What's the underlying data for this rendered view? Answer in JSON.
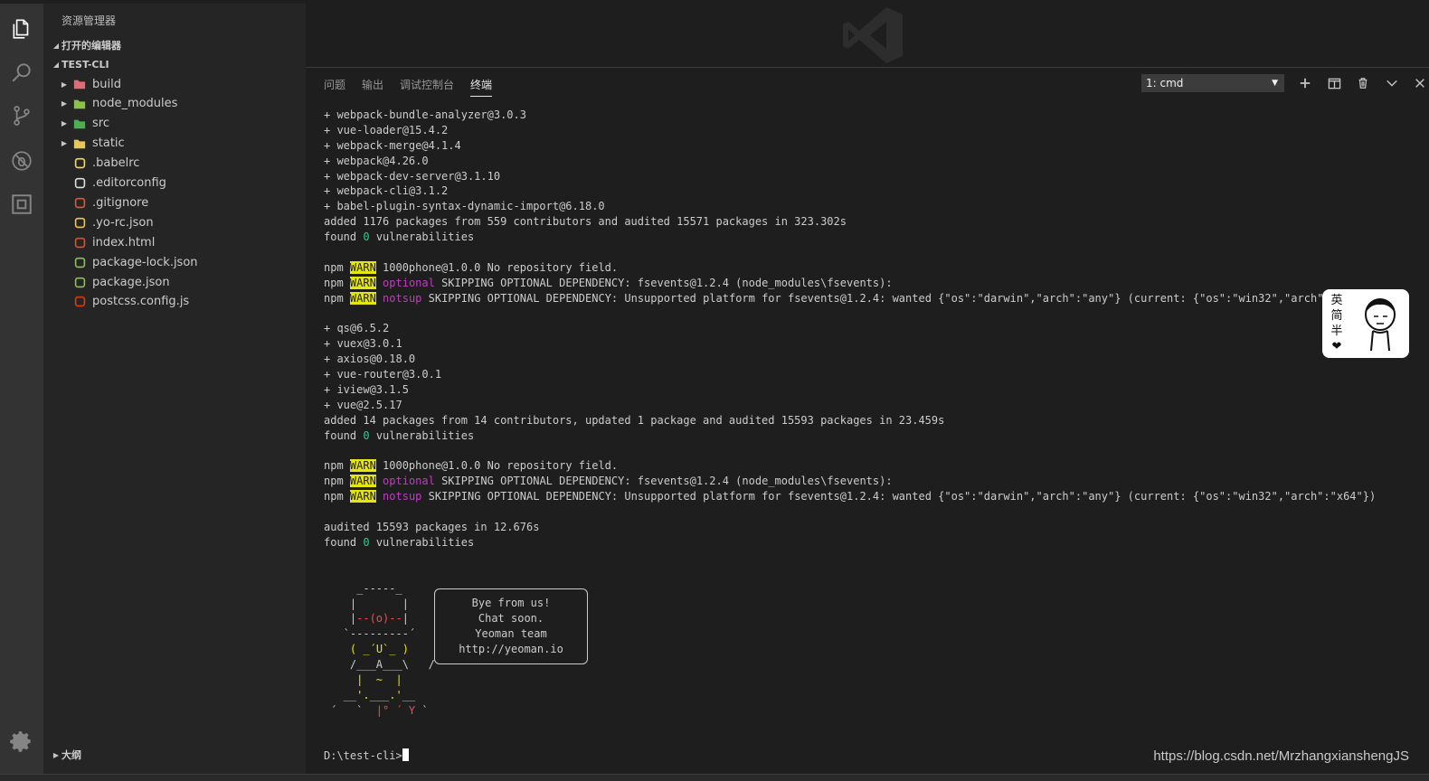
{
  "sidebar": {
    "title": "资源管理器",
    "open_editors": "打开的编辑器",
    "project": "TEST-CLI",
    "outline": "大纲",
    "items": [
      {
        "label": "build",
        "icon": "folder-build-icon",
        "folder": true,
        "color": "#e06c75"
      },
      {
        "label": "node_modules",
        "icon": "folder-node-icon",
        "folder": true,
        "color": "#8bc34a"
      },
      {
        "label": "src",
        "icon": "folder-src-icon",
        "folder": true,
        "color": "#4caf50"
      },
      {
        "label": "static",
        "icon": "folder-icon",
        "folder": true,
        "color": "#e8c75a"
      },
      {
        "label": ".babelrc",
        "icon": "babel-icon",
        "folder": false,
        "color": "#f5da55"
      },
      {
        "label": ".editorconfig",
        "icon": "editorconfig-icon",
        "folder": false,
        "color": "#dddddd"
      },
      {
        "label": ".gitignore",
        "icon": "git-icon",
        "folder": false,
        "color": "#e4572e"
      },
      {
        "label": ".yo-rc.json",
        "icon": "json-icon",
        "folder": false,
        "color": "#f5c542"
      },
      {
        "label": "index.html",
        "icon": "html5-icon",
        "folder": false,
        "color": "#e44d26"
      },
      {
        "label": "package-lock.json",
        "icon": "npm-icon",
        "folder": false,
        "color": "#8bc34a"
      },
      {
        "label": "package.json",
        "icon": "npm-icon",
        "folder": false,
        "color": "#8bc34a"
      },
      {
        "label": "postcss.config.js",
        "icon": "postcss-icon",
        "folder": false,
        "color": "#dd3a0a"
      }
    ]
  },
  "panel": {
    "tabs": [
      "问题",
      "输出",
      "调试控制台",
      "终端"
    ],
    "active_tab": "终端",
    "terminal_select": "1: cmd"
  },
  "terminal": {
    "lines": [
      [
        {
          "t": "+ webpack-bundle-analyzer@3.0.3"
        }
      ],
      [
        {
          "t": "+ vue-loader@15.4.2"
        }
      ],
      [
        {
          "t": "+ webpack-merge@4.1.4"
        }
      ],
      [
        {
          "t": "+ webpack@4.26.0"
        }
      ],
      [
        {
          "t": "+ webpack-dev-server@3.1.10"
        }
      ],
      [
        {
          "t": "+ webpack-cli@3.1.2"
        }
      ],
      [
        {
          "t": "+ babel-plugin-syntax-dynamic-import@6.18.0"
        }
      ],
      [
        {
          "t": "added 1176 packages from 559 contributors and audited 15571 packages in 323.302s"
        }
      ],
      [
        {
          "t": "found "
        },
        {
          "t": "0",
          "c": "grn"
        },
        {
          "t": " vulnerabilities"
        }
      ],
      [],
      [
        {
          "t": "npm "
        },
        {
          "t": "WARN",
          "c": "warn"
        },
        {
          "t": " 1000phone@1.0.0 No repository field."
        }
      ],
      [
        {
          "t": "npm "
        },
        {
          "t": "WARN",
          "c": "warn"
        },
        {
          "t": " "
        },
        {
          "t": "optional",
          "c": "mag"
        },
        {
          "t": " SKIPPING OPTIONAL DEPENDENCY: fsevents@1.2.4 (node_modules\\fsevents):"
        }
      ],
      [
        {
          "t": "npm "
        },
        {
          "t": "WARN",
          "c": "warn"
        },
        {
          "t": " "
        },
        {
          "t": "notsup",
          "c": "mag"
        },
        {
          "t": " SKIPPING OPTIONAL DEPENDENCY: Unsupported platform for fsevents@1.2.4: wanted {\"os\":\"darwin\",\"arch\":\"any\"} (current: {\"os\":\"win32\",\"arch\":\"x64"
        }
      ],
      [],
      [
        {
          "t": "+ qs@6.5.2"
        }
      ],
      [
        {
          "t": "+ vuex@3.0.1"
        }
      ],
      [
        {
          "t": "+ axios@0.18.0"
        }
      ],
      [
        {
          "t": "+ vue-router@3.0.1"
        }
      ],
      [
        {
          "t": "+ iview@3.1.5"
        }
      ],
      [
        {
          "t": "+ vue@2.5.17"
        }
      ],
      [
        {
          "t": "added 14 packages from 14 contributors, updated 1 package and audited 15593 packages in 23.459s"
        }
      ],
      [
        {
          "t": "found "
        },
        {
          "t": "0",
          "c": "grn"
        },
        {
          "t": " vulnerabilities"
        }
      ],
      [],
      [
        {
          "t": "npm "
        },
        {
          "t": "WARN",
          "c": "warn"
        },
        {
          "t": " 1000phone@1.0.0 No repository field."
        }
      ],
      [
        {
          "t": "npm "
        },
        {
          "t": "WARN",
          "c": "warn"
        },
        {
          "t": " "
        },
        {
          "t": "optional",
          "c": "mag"
        },
        {
          "t": " SKIPPING OPTIONAL DEPENDENCY: fsevents@1.2.4 (node_modules\\fsevents):"
        }
      ],
      [
        {
          "t": "npm "
        },
        {
          "t": "WARN",
          "c": "warn"
        },
        {
          "t": " "
        },
        {
          "t": "notsup",
          "c": "mag"
        },
        {
          "t": " SKIPPING OPTIONAL DEPENDENCY: Unsupported platform for fsevents@1.2.4: wanted {\"os\":\"darwin\",\"arch\":\"any\"} (current: {\"os\":\"win32\",\"arch\":\"x64\"})"
        }
      ],
      [],
      [
        {
          "t": "audited 15593 packages in 12.676s"
        }
      ],
      [
        {
          "t": "found "
        },
        {
          "t": "0",
          "c": "grn"
        },
        {
          "t": " vulnerabilities"
        }
      ],
      [],
      [],
      [
        {
          "t": "     _-----_     "
        }
      ],
      [
        {
          "t": "    |       |    "
        }
      ],
      [
        {
          "t": "    |"
        },
        {
          "t": "--(o)--",
          "c": "red"
        },
        {
          "t": "|    "
        }
      ],
      [
        {
          "t": "   `---------´   "
        }
      ],
      [
        {
          "t": "    "
        },
        {
          "t": "( ",
          "c": "ylw"
        },
        {
          "t": "_",
          "c": "ylw"
        },
        {
          "t": "´U`",
          "c": "ylw"
        },
        {
          "t": "_",
          "c": "ylw"
        },
        {
          "t": " )",
          "c": "ylw"
        },
        {
          "t": "    "
        }
      ],
      [
        {
          "t": "    /___A___\\   /"
        }
      ],
      [
        {
          "t": "     "
        },
        {
          "t": "|  ~  |",
          "c": "ylw"
        },
        {
          "t": "     "
        }
      ],
      [
        {
          "t": "   __"
        },
        {
          "t": "'.___.'",
          "c": "ylw"
        },
        {
          "t": "__   "
        }
      ],
      [
        {
          "t": " ´   `  "
        },
        {
          "t": "|° ´ Y",
          "c": "red"
        },
        {
          "t": " ` "
        }
      ],
      [],
      [],
      [
        {
          "t": "D:\\test-cli>"
        }
      ]
    ],
    "yeoman_box": [
      "Bye from us!",
      "Chat soon.",
      "Yeoman team",
      "http://yeoman.io"
    ]
  },
  "ime": {
    "chars": [
      "英",
      "简",
      "半",
      "❤"
    ]
  },
  "watermark": "https://blog.csdn.net/MrzhangxianshengJS",
  "colors": {
    "accent": "#e5e510",
    "magenta": "#bc3fbc",
    "green": "#23d18b",
    "red": "#f14c4c"
  }
}
